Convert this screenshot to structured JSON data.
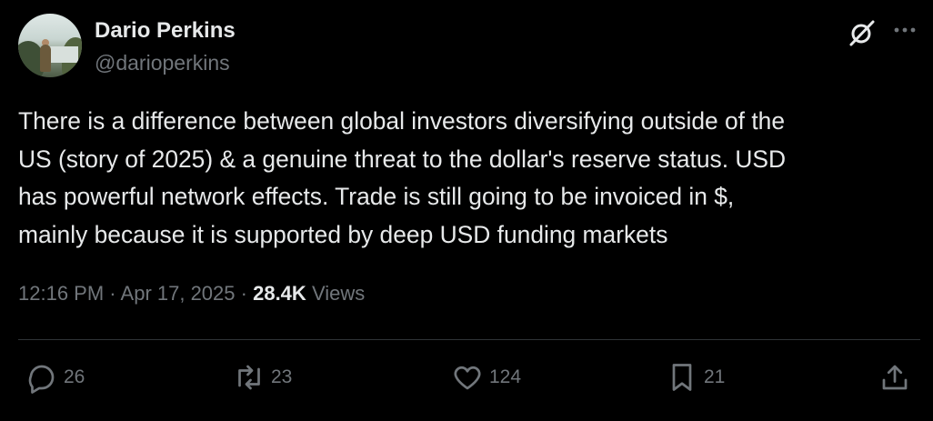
{
  "author": {
    "name": "Dario Perkins",
    "handle": "@darioperkins"
  },
  "header_icons": {
    "grok": "grok-icon",
    "more": "more-icon"
  },
  "tweet": {
    "lines": [
      "There is a difference between global investors diversifying outside of the",
      "US (story of 2025) & a genuine threat to the dollar's reserve status. USD",
      "has powerful network effects. Trade is still going to be invoiced in $,",
      "mainly because it is supported by deep USD funding markets"
    ]
  },
  "meta": {
    "time": "12:16 PM",
    "separator": "·",
    "date": "Apr 17, 2025",
    "views_count": "28.4K",
    "views_label": "Views"
  },
  "actions": {
    "replies": "26",
    "reposts": "23",
    "likes": "124",
    "bookmarks": "21"
  },
  "colors": {
    "background": "#000000",
    "text": "#e7e9ea",
    "secondary": "#71767b",
    "divider": "#2f3336"
  }
}
